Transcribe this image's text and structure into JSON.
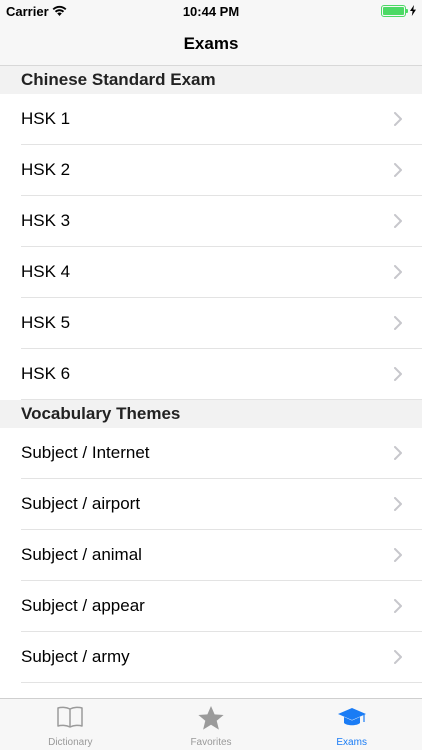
{
  "status_bar": {
    "carrier": "Carrier",
    "time": "10:44 PM",
    "battery_level": 1.0
  },
  "nav": {
    "title": "Exams"
  },
  "sections": [
    {
      "header": "Chinese Standard Exam",
      "rows": [
        {
          "label": "HSK 1"
        },
        {
          "label": "HSK 2"
        },
        {
          "label": "HSK 3"
        },
        {
          "label": "HSK 4"
        },
        {
          "label": "HSK 5"
        },
        {
          "label": "HSK 6"
        }
      ]
    },
    {
      "header": "Vocabulary Themes",
      "rows": [
        {
          "label": "Subject / Internet"
        },
        {
          "label": "Subject / airport"
        },
        {
          "label": "Subject / animal"
        },
        {
          "label": "Subject / appear"
        },
        {
          "label": "Subject / army"
        }
      ]
    }
  ],
  "tabs": [
    {
      "label": "Dictionary",
      "icon": "book-icon",
      "active": false
    },
    {
      "label": "Favorites",
      "icon": "star-icon",
      "active": false
    },
    {
      "label": "Exams",
      "icon": "graduation-cap-icon",
      "active": true
    }
  ],
  "colors": {
    "accent": "#1a7cf5",
    "inactive": "#999999",
    "battery": "#4cd964"
  }
}
